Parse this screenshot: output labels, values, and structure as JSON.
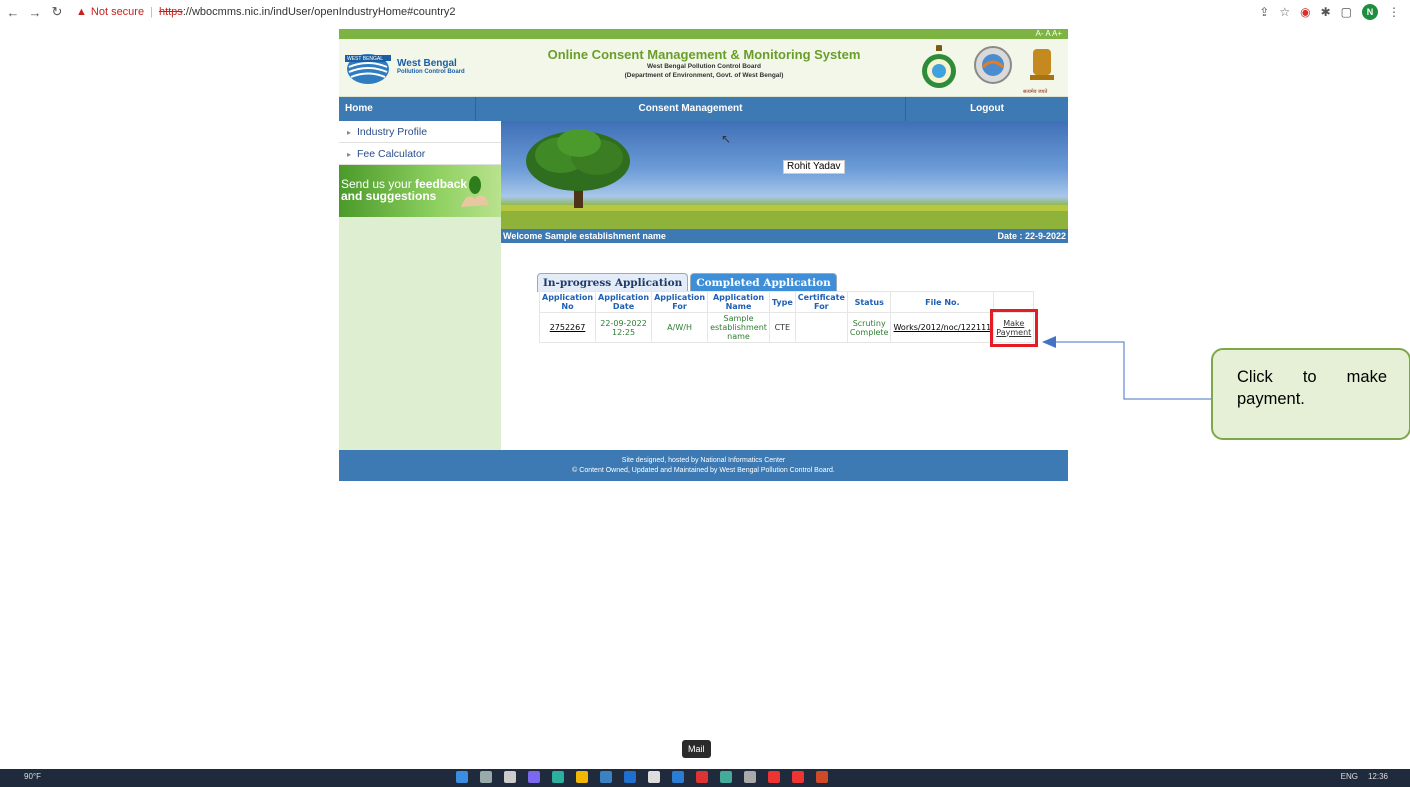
{
  "browser": {
    "not_secure": "Not secure",
    "url_scheme": "https",
    "url_rest": "://wbocmms.nic.in/indUser/openIndustryHome#country2",
    "avatar_letter": "N"
  },
  "site": {
    "accessibility_text": "A- A A+",
    "logo_banner": "WEST BENGAL",
    "logo_title": "West Bengal",
    "logo_subtitle": "Pollution Control Board",
    "title": "Online Consent Management & Monitoring System",
    "subtitle1": "West Bengal Pollution Control Board",
    "subtitle2": "(Department of Environment, Govt. of West Bengal)",
    "emblem_caption": "सत्यमेव जयते"
  },
  "menu": {
    "home": "Home",
    "consent": "Consent Management",
    "logout": "Logout"
  },
  "sidebar": {
    "items": [
      {
        "label": "Industry Profile"
      },
      {
        "label": "Fee Calculator"
      }
    ],
    "feedback_line1": "Send us your ",
    "feedback_bold1": "feedback",
    "feedback_line2": "and suggestions"
  },
  "banner": {
    "user": "Rohit Yadav"
  },
  "welcome": {
    "text": "Welcome Sample establishment name",
    "date": "Date : 22-9-2022"
  },
  "tabs": {
    "inprogress": "In-progress Application",
    "completed": "Completed Application"
  },
  "table": {
    "headers": {
      "app_no": "Application No",
      "app_date": "Application Date",
      "app_for": "Application For",
      "app_name": "Application Name",
      "type": "Type",
      "cert_for": "Certificate For",
      "status": "Status",
      "file_no": "File No."
    },
    "row": {
      "app_no": "2752267",
      "app_date": "22-09-2022 12:25",
      "app_for": "A/W/H",
      "app_name": "Sample establishment name",
      "type": "CTE",
      "cert_for": "",
      "status": "Scrutiny Complete",
      "file_no": "Works/2012/noc/122111",
      "action": "Make Payment"
    }
  },
  "footer": {
    "line1": "Site designed, hosted by National Informatics Center",
    "line2": "© Content Owned, Updated and Maintained by West Bengal Pollution Control Board."
  },
  "callout": {
    "text": "Click to make payment."
  },
  "taskbar": {
    "tooltip": "Mail",
    "weather": "90°F",
    "lang": "ENG",
    "time": "12:36"
  },
  "colors": {
    "menu_blue": "#3d7ab3",
    "accent_green": "#7cb342",
    "highlight_red": "#e51c23",
    "callout_border": "#7da84a"
  }
}
